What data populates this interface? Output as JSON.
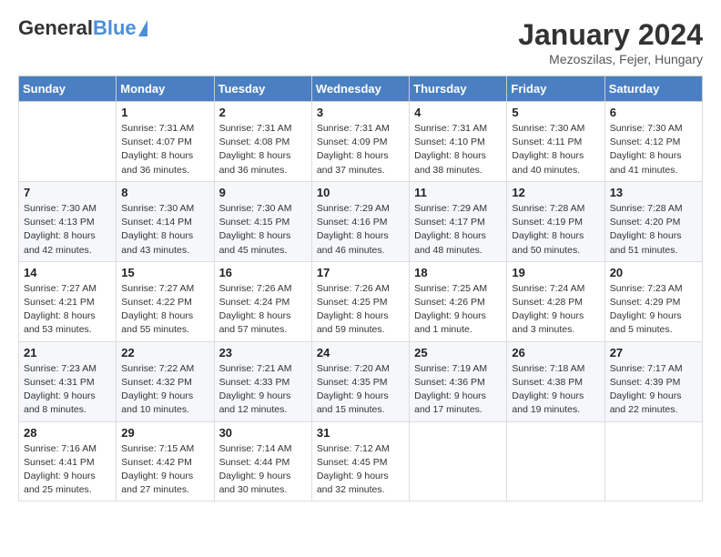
{
  "header": {
    "logo_general": "General",
    "logo_blue": "Blue",
    "month_year": "January 2024",
    "location": "Mezoszilas, Fejer, Hungary"
  },
  "days_of_week": [
    "Sunday",
    "Monday",
    "Tuesday",
    "Wednesday",
    "Thursday",
    "Friday",
    "Saturday"
  ],
  "weeks": [
    [
      {
        "day": "",
        "info": ""
      },
      {
        "day": "1",
        "info": "Sunrise: 7:31 AM\nSunset: 4:07 PM\nDaylight: 8 hours\nand 36 minutes."
      },
      {
        "day": "2",
        "info": "Sunrise: 7:31 AM\nSunset: 4:08 PM\nDaylight: 8 hours\nand 36 minutes."
      },
      {
        "day": "3",
        "info": "Sunrise: 7:31 AM\nSunset: 4:09 PM\nDaylight: 8 hours\nand 37 minutes."
      },
      {
        "day": "4",
        "info": "Sunrise: 7:31 AM\nSunset: 4:10 PM\nDaylight: 8 hours\nand 38 minutes."
      },
      {
        "day": "5",
        "info": "Sunrise: 7:30 AM\nSunset: 4:11 PM\nDaylight: 8 hours\nand 40 minutes."
      },
      {
        "day": "6",
        "info": "Sunrise: 7:30 AM\nSunset: 4:12 PM\nDaylight: 8 hours\nand 41 minutes."
      }
    ],
    [
      {
        "day": "7",
        "info": "Sunrise: 7:30 AM\nSunset: 4:13 PM\nDaylight: 8 hours\nand 42 minutes."
      },
      {
        "day": "8",
        "info": "Sunrise: 7:30 AM\nSunset: 4:14 PM\nDaylight: 8 hours\nand 43 minutes."
      },
      {
        "day": "9",
        "info": "Sunrise: 7:30 AM\nSunset: 4:15 PM\nDaylight: 8 hours\nand 45 minutes."
      },
      {
        "day": "10",
        "info": "Sunrise: 7:29 AM\nSunset: 4:16 PM\nDaylight: 8 hours\nand 46 minutes."
      },
      {
        "day": "11",
        "info": "Sunrise: 7:29 AM\nSunset: 4:17 PM\nDaylight: 8 hours\nand 48 minutes."
      },
      {
        "day": "12",
        "info": "Sunrise: 7:28 AM\nSunset: 4:19 PM\nDaylight: 8 hours\nand 50 minutes."
      },
      {
        "day": "13",
        "info": "Sunrise: 7:28 AM\nSunset: 4:20 PM\nDaylight: 8 hours\nand 51 minutes."
      }
    ],
    [
      {
        "day": "14",
        "info": "Sunrise: 7:27 AM\nSunset: 4:21 PM\nDaylight: 8 hours\nand 53 minutes."
      },
      {
        "day": "15",
        "info": "Sunrise: 7:27 AM\nSunset: 4:22 PM\nDaylight: 8 hours\nand 55 minutes."
      },
      {
        "day": "16",
        "info": "Sunrise: 7:26 AM\nSunset: 4:24 PM\nDaylight: 8 hours\nand 57 minutes."
      },
      {
        "day": "17",
        "info": "Sunrise: 7:26 AM\nSunset: 4:25 PM\nDaylight: 8 hours\nand 59 minutes."
      },
      {
        "day": "18",
        "info": "Sunrise: 7:25 AM\nSunset: 4:26 PM\nDaylight: 9 hours\nand 1 minute."
      },
      {
        "day": "19",
        "info": "Sunrise: 7:24 AM\nSunset: 4:28 PM\nDaylight: 9 hours\nand 3 minutes."
      },
      {
        "day": "20",
        "info": "Sunrise: 7:23 AM\nSunset: 4:29 PM\nDaylight: 9 hours\nand 5 minutes."
      }
    ],
    [
      {
        "day": "21",
        "info": "Sunrise: 7:23 AM\nSunset: 4:31 PM\nDaylight: 9 hours\nand 8 minutes."
      },
      {
        "day": "22",
        "info": "Sunrise: 7:22 AM\nSunset: 4:32 PM\nDaylight: 9 hours\nand 10 minutes."
      },
      {
        "day": "23",
        "info": "Sunrise: 7:21 AM\nSunset: 4:33 PM\nDaylight: 9 hours\nand 12 minutes."
      },
      {
        "day": "24",
        "info": "Sunrise: 7:20 AM\nSunset: 4:35 PM\nDaylight: 9 hours\nand 15 minutes."
      },
      {
        "day": "25",
        "info": "Sunrise: 7:19 AM\nSunset: 4:36 PM\nDaylight: 9 hours\nand 17 minutes."
      },
      {
        "day": "26",
        "info": "Sunrise: 7:18 AM\nSunset: 4:38 PM\nDaylight: 9 hours\nand 19 minutes."
      },
      {
        "day": "27",
        "info": "Sunrise: 7:17 AM\nSunset: 4:39 PM\nDaylight: 9 hours\nand 22 minutes."
      }
    ],
    [
      {
        "day": "28",
        "info": "Sunrise: 7:16 AM\nSunset: 4:41 PM\nDaylight: 9 hours\nand 25 minutes."
      },
      {
        "day": "29",
        "info": "Sunrise: 7:15 AM\nSunset: 4:42 PM\nDaylight: 9 hours\nand 27 minutes."
      },
      {
        "day": "30",
        "info": "Sunrise: 7:14 AM\nSunset: 4:44 PM\nDaylight: 9 hours\nand 30 minutes."
      },
      {
        "day": "31",
        "info": "Sunrise: 7:12 AM\nSunset: 4:45 PM\nDaylight: 9 hours\nand 32 minutes."
      },
      {
        "day": "",
        "info": ""
      },
      {
        "day": "",
        "info": ""
      },
      {
        "day": "",
        "info": ""
      }
    ]
  ]
}
